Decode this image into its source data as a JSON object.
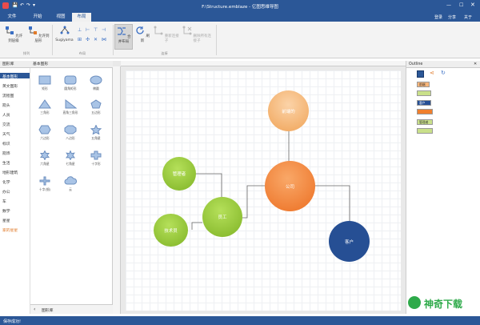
{
  "window": {
    "title": "F:\\Structure.emblaze - 亿图思维导图"
  },
  "titlebar": {
    "right_items": [
      "登录",
      "分享",
      "关于"
    ]
  },
  "menu": {
    "tabs": [
      "文件",
      "开始",
      "视图",
      "布局"
    ],
    "active": "布局"
  },
  "ribbon": {
    "buttons": [
      "允许到层级",
      "允许到层形",
      "Sugiyama",
      "合并布局",
      "刷新",
      "重新连接子",
      "删除所有连接子"
    ],
    "groups": [
      "排列",
      "布局",
      "连接"
    ]
  },
  "left_tree": {
    "header": "图形库",
    "items": [
      "基本图形",
      "英文图形",
      "流程图",
      "箭头",
      "人员",
      "交流",
      "天气",
      "标识",
      "箭饰",
      "生活",
      "地形建筑",
      "化学",
      "办公",
      "车",
      "数学",
      "星星",
      "家的星星"
    ]
  },
  "shape_panel": {
    "header": "基本图形",
    "shapes": [
      "矩形",
      "圆角矩形",
      "椭圆",
      "三角形",
      "直角三角形",
      "五边形",
      "六边形",
      "八边形",
      "五角星",
      "六角星",
      "七角星",
      "十字形",
      "十字(细)",
      "云"
    ],
    "footer": "图形库"
  },
  "diagram": {
    "nodes": [
      {
        "id": "top",
        "label": "前端的",
        "color": "#f7b57a"
      },
      {
        "id": "company",
        "label": "公司",
        "color": "#f07f2d"
      },
      {
        "id": "customer",
        "label": "客户",
        "color": "#264f94"
      },
      {
        "id": "employee",
        "label": "员工",
        "color": "#8fc32e"
      },
      {
        "id": "manager",
        "label": "管理者",
        "color": "#8fc32e"
      },
      {
        "id": "tech",
        "label": "技术员",
        "color": "#8fc32e"
      }
    ]
  },
  "outline": {
    "title": "Outline",
    "tags": [
      {
        "label": "前端",
        "color": "#f7b57a"
      },
      {
        "label": "",
        "color": "#c9e08a"
      },
      {
        "label": "客户",
        "color": "#264f94"
      },
      {
        "label": "",
        "color": "#f07f2d"
      },
      {
        "label": "管理者",
        "color": "#c9e08a"
      },
      {
        "label": "",
        "color": "#c9e08a"
      }
    ]
  },
  "status": {
    "text": "保存成功!"
  },
  "watermark": {
    "text": "神奇下载"
  }
}
